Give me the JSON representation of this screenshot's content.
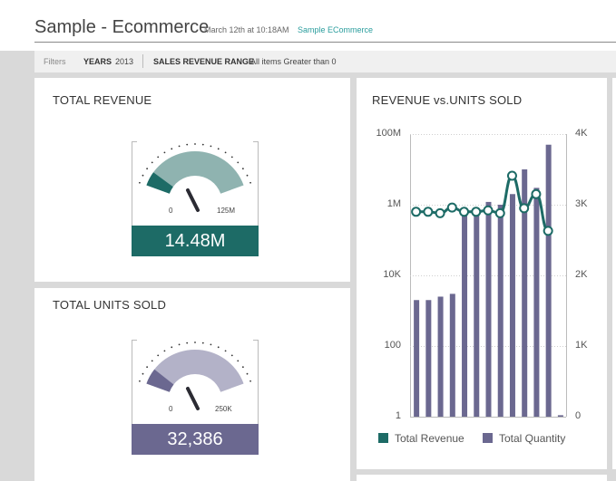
{
  "header": {
    "title": "Sample - Ecommerce",
    "timestamp": "March 12th at 10:18AM",
    "dashboard_link": "Sample ECommerce"
  },
  "filters": {
    "label": "Filters",
    "years_key": "YEARS",
    "years_value": "2013",
    "range_key": "SALES REVENUE RANGE",
    "range_value": "All items Greater than 0"
  },
  "total_revenue": {
    "title": "TOTAL REVENUE",
    "min_label": "0",
    "max_label": "125M",
    "value_label": "14.48M",
    "fill_fraction": 0.116,
    "color": "#1d6b66",
    "track_color": "#8fb3b0"
  },
  "total_units": {
    "title": "TOTAL UNITS SOLD",
    "min_label": "0",
    "max_label": "250K",
    "value_label": "32,386",
    "fill_fraction": 0.13,
    "color": "#6b6890",
    "track_color": "#b3b2c8"
  },
  "chart_data": {
    "type": "bar",
    "title": "REVENUE vs.UNITS SOLD",
    "left_axis": {
      "scale": "log",
      "ticks": [
        "100M",
        "1M",
        "10K",
        "100",
        "1"
      ]
    },
    "right_axis": {
      "scale": "linear",
      "ticks": [
        "4K",
        "3K",
        "2K",
        "1K",
        "0"
      ],
      "ylim": [
        0,
        4000
      ]
    },
    "series": [
      {
        "name": "Total Revenue",
        "kind": "line",
        "axis": "right",
        "color": "#1d6b66",
        "values": [
          2900,
          2900,
          2880,
          2960,
          2900,
          2900,
          2920,
          2880,
          3410,
          2950,
          3150,
          2630
        ]
      },
      {
        "name": "Total Quantity",
        "kind": "bar",
        "axis": "left",
        "color": "#6b6890",
        "values": [
          2000,
          2000,
          2500,
          3000,
          600000,
          500000,
          1200000,
          1000000,
          2000000,
          10000000,
          3000000,
          50000000,
          1.1
        ]
      }
    ],
    "legend_position": "bottom",
    "grid": true
  }
}
